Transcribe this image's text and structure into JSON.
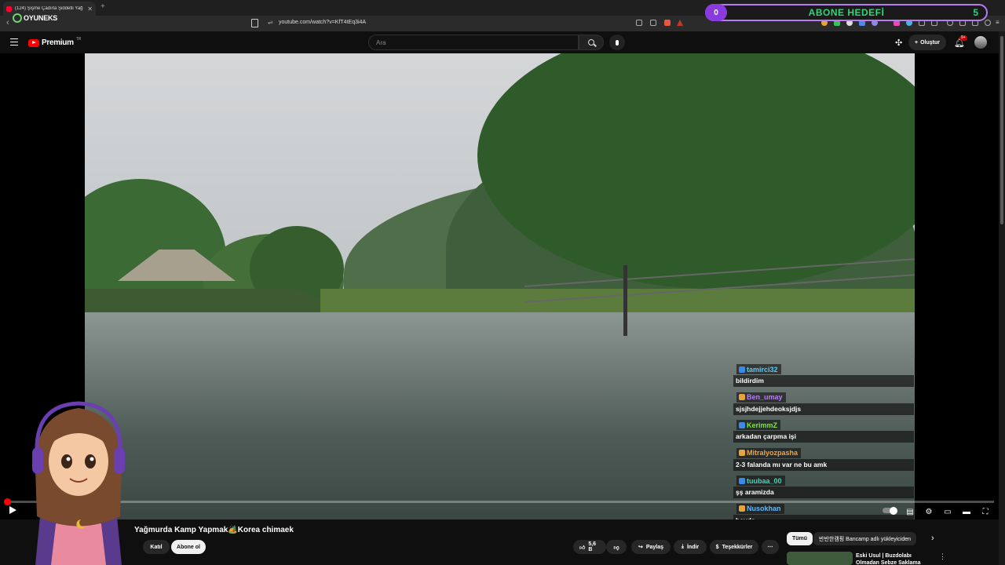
{
  "browser": {
    "tab_title": "(124) Şişme Çadırla Şiddetli Yağ",
    "url": "youtube.com/watch?v=KfT4tEq3i4A"
  },
  "overlay": {
    "logo_text": "OYUNEKS",
    "goal_label": "ABONE HEDEFİ",
    "goal_current": "0",
    "goal_target": "5"
  },
  "youtube": {
    "logo_word": "Premium",
    "logo_country": "TR",
    "search_placeholder": "Ara",
    "create_label": "Oluştur",
    "notif_count": "9+"
  },
  "player": {
    "progress_fraction": 0.002
  },
  "chat": [
    {
      "user": "tamirci32",
      "color": "#5ec8f0",
      "text": "bildirdim"
    },
    {
      "user": "Ben_umay",
      "color": "#b97df5",
      "text": "sjsjhdejjehdeoksjdjs"
    },
    {
      "user": "KerimmZ",
      "color": "#7fe34a",
      "text": "arkadan çarpma işi"
    },
    {
      "user": "Mitralyozpasha",
      "color": "#f0a640",
      "text": "2-3 falanda mı var ne bu amk"
    },
    {
      "user": "tuubaa_00",
      "color": "#3fd6b8",
      "text": "şş aramizda"
    },
    {
      "user": "Nusokhan",
      "color": "#6ab6f5",
      "text": "hayda"
    }
  ],
  "video": {
    "title": "Yağmurda Kamp Yapmak🏕️Korea chimaek",
    "join_label": "Katıl",
    "subscribe_label": "Abone ol",
    "like_count": "5,6 B",
    "share_label": "Paylaş",
    "download_label": "İndir",
    "thanks_label": "Teşekkürler"
  },
  "sidebar": {
    "chip_all": "Tümü",
    "chip_2": "반반한캠핑 Bancamp adlı yükleyiciden",
    "rec_title": "Eski Usul | Buzdolabı Olmadan Sebze Saklama"
  }
}
